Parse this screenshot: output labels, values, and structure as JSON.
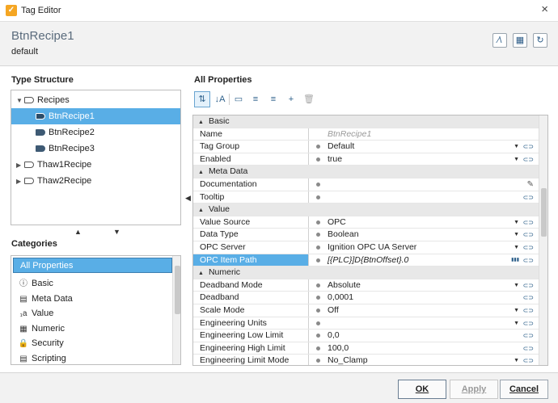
{
  "window": {
    "title": "Tag Editor",
    "close_icon": "×"
  },
  "header": {
    "tag_name": "BtnRecipe1",
    "provider": "default"
  },
  "type_structure": {
    "label": "Type Structure",
    "items": [
      {
        "label": "Recipes",
        "level": 0,
        "expanded": true,
        "folder": true
      },
      {
        "label": "BtnRecipe1",
        "level": 1,
        "selected": true
      },
      {
        "label": "BtnRecipe2",
        "level": 1
      },
      {
        "label": "BtnRecipe3",
        "level": 1
      },
      {
        "label": "Thaw1Recipe",
        "level": 0,
        "expanded": false,
        "folder": true
      },
      {
        "label": "Thaw2Recipe",
        "level": 0,
        "expanded": false,
        "folder": true
      }
    ]
  },
  "categories": {
    "label": "Categories",
    "items": [
      {
        "label": "All Properties",
        "icon": "none",
        "selected": true
      },
      {
        "label": "Basic",
        "icon": "info-icon"
      },
      {
        "label": "Meta Data",
        "icon": "metadata-icon"
      },
      {
        "label": "Value",
        "icon": "value-icon"
      },
      {
        "label": "Numeric",
        "icon": "calculator-icon"
      },
      {
        "label": "Security",
        "icon": "lock-icon"
      },
      {
        "label": "Scripting",
        "icon": "script-icon"
      }
    ]
  },
  "all_properties": {
    "label": "All Properties",
    "rows": [
      {
        "type": "cat",
        "name": "Basic"
      },
      {
        "name": "Name",
        "value": "BtnRecipe1",
        "placeholder": true
      },
      {
        "name": "Tag Group",
        "value": "Default",
        "dot": true,
        "dropdown": true,
        "link": true
      },
      {
        "name": "Enabled",
        "value": "true",
        "dot": true,
        "dropdown": true,
        "link": true
      },
      {
        "type": "cat",
        "name": "Meta Data"
      },
      {
        "name": "Documentation",
        "value": "",
        "dot": true,
        "pencil": true
      },
      {
        "name": "Tooltip",
        "value": "",
        "dot": true,
        "link": true
      },
      {
        "type": "cat",
        "name": "Value"
      },
      {
        "name": "Value Source",
        "value": "OPC",
        "dot": true,
        "dropdown": true,
        "link": true
      },
      {
        "name": "Data Type",
        "value": "Boolean",
        "dot": true,
        "dropdown": true,
        "link": true
      },
      {
        "name": "OPC Server",
        "value": "Ignition OPC UA Server",
        "dot": true,
        "dropdown": true,
        "link": true
      },
      {
        "name": "OPC Item Path",
        "value": "[{PLC}]D{BtnOffset}.0",
        "dot": true,
        "italic": true,
        "highlighted": true,
        "browse": true,
        "link": true
      },
      {
        "type": "cat",
        "name": "Numeric"
      },
      {
        "name": "Deadband Mode",
        "value": "Absolute",
        "dot": true,
        "dropdown": true,
        "link": true
      },
      {
        "name": "Deadband",
        "value": "0,0001",
        "dot": true,
        "link": true
      },
      {
        "name": "Scale Mode",
        "value": "Off",
        "dot": true,
        "dropdown": true,
        "link": true
      },
      {
        "name": "Engineering Units",
        "value": "",
        "dot": true,
        "dropdown": true,
        "link": true
      },
      {
        "name": "Engineering Low Limit",
        "value": "0,0",
        "dot": true,
        "link": true
      },
      {
        "name": "Engineering High Limit",
        "value": "100,0",
        "dot": true,
        "link": true
      },
      {
        "name": "Engineering Limit Mode",
        "value": "No_Clamp",
        "dot": true,
        "dropdown": true,
        "link": true
      }
    ]
  },
  "footer": {
    "ok": "OK",
    "apply": "Apply",
    "cancel": "Cancel"
  }
}
